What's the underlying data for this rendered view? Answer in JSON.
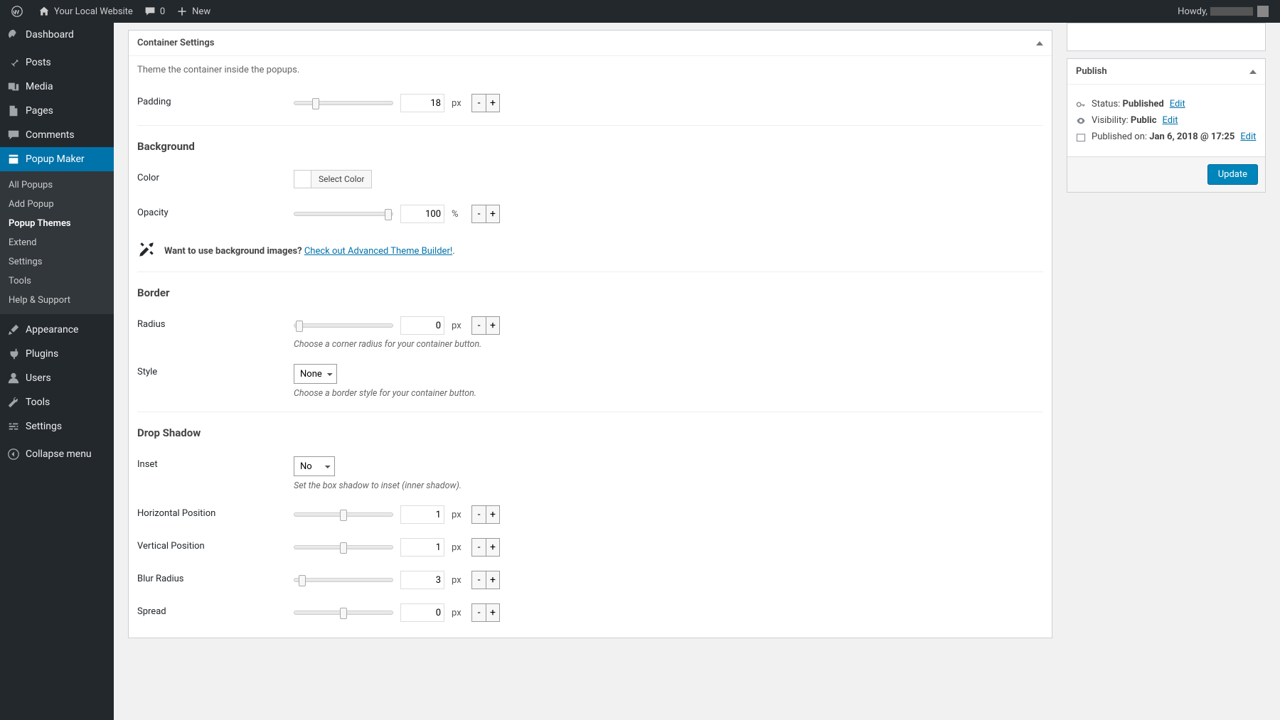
{
  "adminbar": {
    "site": "Your Local Website",
    "comments": "0",
    "new": "New",
    "howdy": "Howdy,"
  },
  "sidebar": {
    "dashboard": "Dashboard",
    "posts": "Posts",
    "media": "Media",
    "pages": "Pages",
    "comments": "Comments",
    "popup_maker": "Popup Maker",
    "submenu": {
      "all": "All Popups",
      "add": "Add Popup",
      "themes": "Popup Themes",
      "extend": "Extend",
      "settings": "Settings",
      "tools": "Tools",
      "help": "Help & Support"
    },
    "appearance": "Appearance",
    "plugins": "Plugins",
    "users": "Users",
    "tools": "Tools",
    "settings": "Settings",
    "collapse": "Collapse menu"
  },
  "panel": {
    "title": "Container Settings",
    "desc": "Theme the container inside the popups."
  },
  "padding": {
    "label": "Padding",
    "value": "18",
    "unit": "px"
  },
  "bg": {
    "title": "Background",
    "color_label": "Color",
    "select_color": "Select Color",
    "opacity_label": "Opacity",
    "opacity_value": "100",
    "opacity_unit": "%"
  },
  "promo": {
    "text": "Want to use background images? ",
    "link": "Check out Advanced Theme Builder!"
  },
  "border": {
    "title": "Border",
    "radius_label": "Radius",
    "radius_value": "0",
    "radius_unit": "px",
    "radius_hint": "Choose a corner radius for your container button.",
    "style_label": "Style",
    "style_value": "None",
    "style_hint": "Choose a border style for your container button."
  },
  "shadow": {
    "title": "Drop Shadow",
    "inset_label": "Inset",
    "inset_value": "No",
    "inset_hint": "Set the box shadow to inset (inner shadow).",
    "hp_label": "Horizontal Position",
    "hp_value": "1",
    "hp_unit": "px",
    "vp_label": "Vertical Position",
    "vp_value": "1",
    "vp_unit": "px",
    "blur_label": "Blur Radius",
    "blur_value": "3",
    "blur_unit": "px",
    "spread_label": "Spread",
    "spread_value": "0",
    "spread_unit": "px"
  },
  "publish": {
    "title": "Publish",
    "status_label": "Status: ",
    "status_value": "Published",
    "visibility_label": "Visibility: ",
    "visibility_value": "Public",
    "published_label": "Published on: ",
    "published_value": "Jan 6, 2018 @ 17:25",
    "edit": "Edit",
    "update": "Update"
  }
}
